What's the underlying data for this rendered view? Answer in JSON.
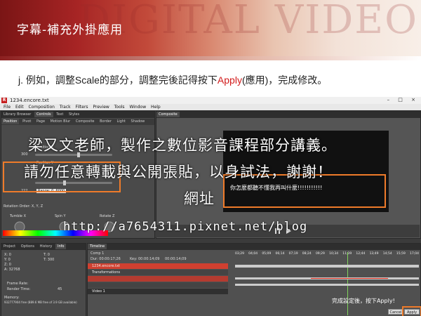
{
  "slide": {
    "title": "字幕-補充外掛應用",
    "logo_text": "DIGITAL VIDEO",
    "instruction_pre": "j. 例如，調整Scale的部分，調整完後記得按下",
    "instruction_apply": "Apply",
    "instruction_post": "(應用)，完成修改。"
  },
  "app": {
    "window_title": "1234.encore.txt",
    "window_controls": "– □ ×",
    "app_icon": "R",
    "menu": [
      "File",
      "Edit",
      "Composition",
      "Track",
      "Filters",
      "Preview",
      "Tools",
      "Window",
      "Help"
    ],
    "left_tabs": [
      "Library Browser",
      "Controls",
      "Text",
      "Styles"
    ],
    "sub_tabs": [
      "Position",
      "Pivot",
      "Page",
      "Motion Blur",
      "Composite",
      "Border",
      "Light",
      "Shadow"
    ],
    "position_label": "Position X",
    "position_y_label": "Position Y",
    "value_1": "300",
    "value_2": "222",
    "range_label": "Range: 0, 6000",
    "rotation_order": "Rotation Order:  X, Y, Z",
    "tumble": "Tumble X",
    "spin": "Spin Y",
    "rotate": "Rotate Z",
    "composite_tab": "Composite",
    "subtitle_text": "你怎麼都聽不懂我再叫什麼!!!!!!!!!!!",
    "info_tabs": [
      "Project",
      "Options",
      "History",
      "Info"
    ],
    "info_rows": [
      {
        "k": "X:",
        "v": "0"
      },
      {
        "k": "Y:",
        "v": "0"
      },
      {
        "k": "Z:",
        "v": "0"
      }
    ],
    "info_xy": [
      "T: 0",
      "T: 300"
    ],
    "info_a": "A: 32768",
    "frame_rate": "Frame Rate:",
    "render_time": "Render Time:",
    "render_val": "45",
    "memory_label": "Memory:",
    "memory_text": "932777904 free (889.6 MB free of 3.9 GB available)",
    "timeline_tab": "Timeline",
    "comp": "Comp 1",
    "dur": "Dur: 00:00:17;26",
    "key": "Key: 00:00:14;09",
    "time": "00:00:14;09",
    "tracks": [
      "1234.encore.txt",
      "Transformations",
      "",
      ""
    ],
    "video_track": "Video 1",
    "ruler": [
      "03;29",
      "04;04",
      "05;09",
      "06;14",
      "07;19",
      "08;24",
      "09;29",
      "10;34",
      "11;39",
      "12;44",
      "13;49",
      "14;54",
      "15;59",
      "17;04"
    ],
    "done_note": "完成設定後，按下Apply!",
    "cancel": "Cancel",
    "apply": "Apply"
  },
  "overlay": {
    "line1": "梁又文老師，製作之數位影音課程部分講義。",
    "line2": "請勿任意轉載與公開張貼，以身試法，謝謝！",
    "line3": "網址",
    "url": "http://a7654311.pixnet.net/blog"
  },
  "colors": {
    "accent": "#ef7b2a",
    "apply_red": "#d21a1a",
    "banner": "#a62424"
  }
}
